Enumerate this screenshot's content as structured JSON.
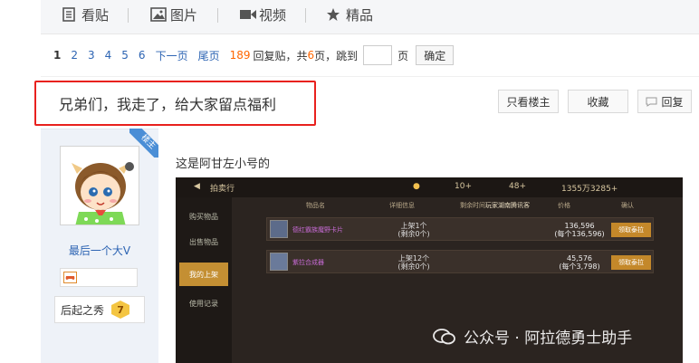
{
  "tabs": {
    "view": "看贴",
    "images": "图片",
    "video": "视频",
    "featured": "精品"
  },
  "pager": {
    "pages": [
      "1",
      "2",
      "3",
      "4",
      "5",
      "6"
    ],
    "next": "下一页",
    "last": "尾页",
    "reply_count": "189",
    "reply_text": "回复贴，共",
    "page_total": "6",
    "page_suffix": "页，跳到",
    "page_unit": "页",
    "confirm": "确定"
  },
  "post": {
    "title": "兄弟们，我走了，给大家留点福利",
    "only_op": "只看楼主",
    "favorite": "收藏",
    "reply": "回复",
    "body_text": "这是阿甘左小号的"
  },
  "user": {
    "badge": "楼主",
    "name": "最后一个大V",
    "level_title": "后起之秀",
    "level": "7"
  },
  "game": {
    "header": "拍卖行",
    "gold": "10+",
    "gems": "48+",
    "money": "1355万3285+",
    "col_item": "物品名",
    "col_detail": "详细信息",
    "col_seller": "剩余时间",
    "col_player": "玩家湖南腾讯客",
    "col_price": "价格",
    "col_confirm": "确认",
    "side": [
      "购买物品",
      "出售物品",
      "我的上架",
      "使用记录"
    ],
    "rows": [
      {
        "name": "德红霸族魔野卡片",
        "up": "上架1个",
        "left": "(剩余0个)",
        "price": "136,596",
        "each": "(每个136,596)",
        "action": "领取泰拉"
      },
      {
        "name": "紫拉合成器",
        "up": "上架12个",
        "left": "(剩余0个)",
        "price": "45,576",
        "each": "(每个3,798)",
        "action": "领取泰拉"
      }
    ]
  },
  "watermark": "公众号 · 阿拉德勇士助手"
}
